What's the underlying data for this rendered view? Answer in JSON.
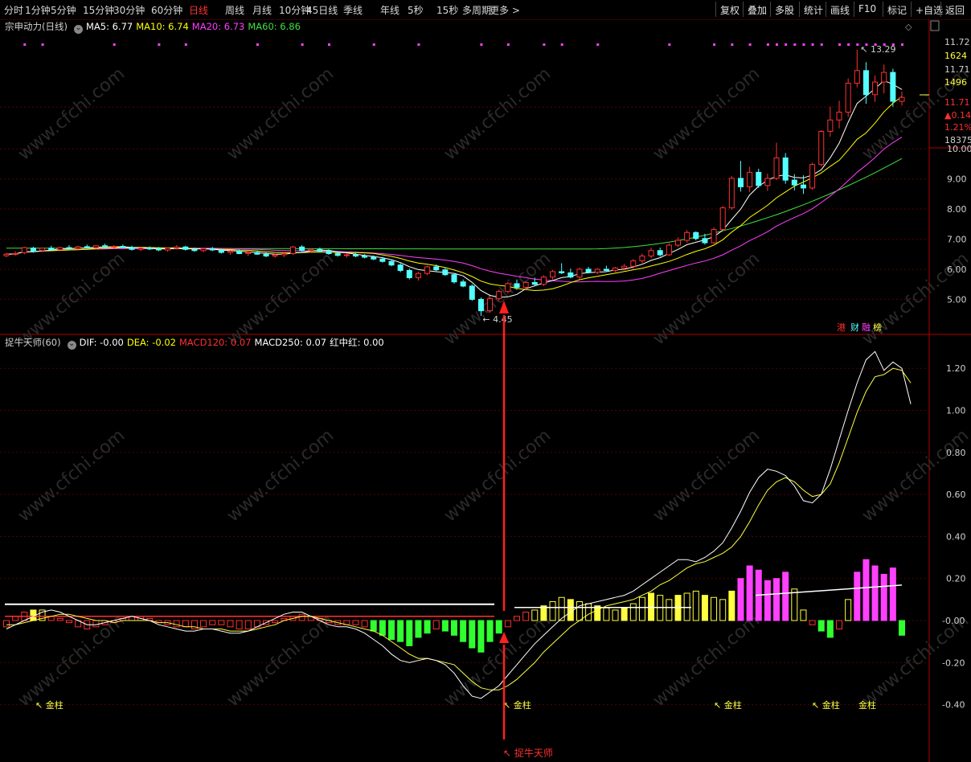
{
  "toolbar": {
    "periods": [
      "分时",
      "1分钟",
      "5分钟",
      "15分钟",
      "30分钟",
      "60分钟",
      "日线",
      "周线",
      "月线",
      "10分钟",
      "45日线",
      "季线",
      "年线",
      "5秒",
      "15秒",
      "多周期",
      "更多 >"
    ],
    "active_period": "日线",
    "right_buttons": [
      "复权",
      "叠加",
      "多股",
      "统计",
      "画线",
      "F10",
      "标记",
      "+自选",
      "返回"
    ]
  },
  "main_legend": {
    "title": "宗申动力(日线)",
    "items": [
      {
        "label": "MA5: 6.77",
        "color": "#ffffff"
      },
      {
        "label": "MA10: 6.74",
        "color": "#ffff00"
      },
      {
        "label": "MA20: 6.73",
        "color": "#ff40ff"
      },
      {
        "label": "MA60: 6.86",
        "color": "#40e040"
      }
    ]
  },
  "indicator_legend": {
    "title": "捉牛天师(60)",
    "items": [
      {
        "label": "DIF: -0.00",
        "color": "#ffffff"
      },
      {
        "label": "DEA: -0.02",
        "color": "#ffff00"
      },
      {
        "label": "MACD120: 0.07",
        "color": "#ff3030"
      },
      {
        "label": "MACD250: 0.07",
        "color": "#ffffff"
      },
      {
        "label": "红中红: 0.00",
        "color": "#ffffff"
      }
    ]
  },
  "right_panel": {
    "price1": "11.72",
    "vol1": "1624",
    "price2": "11.71",
    "vol2": "1496",
    "price3": "11.71",
    "change": "▲0.14",
    "pct": "1.21%",
    "volume": "18375"
  },
  "badges": {
    "gang": "港",
    "caiwu": "财",
    "rongzi": "融",
    "bang": "榜"
  },
  "annotations": {
    "high": "13.29",
    "low": "4.45",
    "jinzhu": "金柱",
    "signal": "捉牛天师"
  },
  "watermark": "www.cfchi.com",
  "chart_data": [
    {
      "type": "candlestick",
      "title": "宗申动力(日线)",
      "y_ticks": [
        5.0,
        6.0,
        7.0,
        8.0,
        9.0,
        10.0,
        11.71
      ],
      "ylim": [
        4.4,
        13.4
      ],
      "annotated_high": 13.29,
      "annotated_low": 4.45,
      "candles": [
        [
          6.45,
          6.55,
          6.4,
          6.5
        ],
        [
          6.5,
          6.6,
          6.45,
          6.52
        ],
        [
          6.55,
          6.75,
          6.5,
          6.72
        ],
        [
          6.7,
          6.75,
          6.55,
          6.6
        ],
        [
          6.62,
          6.72,
          6.58,
          6.7
        ],
        [
          6.7,
          6.78,
          6.6,
          6.65
        ],
        [
          6.65,
          6.75,
          6.6,
          6.72
        ],
        [
          6.72,
          6.8,
          6.65,
          6.7
        ],
        [
          6.7,
          6.78,
          6.62,
          6.75
        ],
        [
          6.75,
          6.82,
          6.7,
          6.72
        ],
        [
          6.72,
          6.8,
          6.68,
          6.78
        ],
        [
          6.78,
          6.85,
          6.7,
          6.74
        ],
        [
          6.74,
          6.8,
          6.68,
          6.76
        ],
        [
          6.76,
          6.82,
          6.7,
          6.72
        ],
        [
          6.72,
          6.78,
          6.62,
          6.66
        ],
        [
          6.66,
          6.74,
          6.6,
          6.7
        ],
        [
          6.7,
          6.76,
          6.64,
          6.68
        ],
        [
          6.68,
          6.74,
          6.6,
          6.64
        ],
        [
          6.64,
          6.72,
          6.58,
          6.7
        ],
        [
          6.7,
          6.8,
          6.66,
          6.74
        ],
        [
          6.74,
          6.78,
          6.62,
          6.66
        ],
        [
          6.66,
          6.72,
          6.58,
          6.62
        ],
        [
          6.62,
          6.7,
          6.56,
          6.68
        ],
        [
          6.68,
          6.74,
          6.6,
          6.64
        ],
        [
          6.64,
          6.68,
          6.52,
          6.56
        ],
        [
          6.56,
          6.64,
          6.48,
          6.6
        ],
        [
          6.6,
          6.66,
          6.5,
          6.52
        ],
        [
          6.52,
          6.6,
          6.44,
          6.56
        ],
        [
          6.56,
          6.62,
          6.48,
          6.5
        ],
        [
          6.5,
          6.56,
          6.4,
          6.44
        ],
        [
          6.44,
          6.52,
          6.38,
          6.48
        ],
        [
          6.48,
          6.56,
          6.4,
          6.52
        ],
        [
          6.52,
          6.78,
          6.48,
          6.74
        ],
        [
          6.74,
          6.8,
          6.58,
          6.62
        ],
        [
          6.62,
          6.7,
          6.54,
          6.66
        ],
        [
          6.66,
          6.72,
          6.56,
          6.6
        ],
        [
          6.6,
          6.66,
          6.48,
          6.52
        ],
        [
          6.52,
          6.58,
          6.42,
          6.46
        ],
        [
          6.46,
          6.52,
          6.38,
          6.48
        ],
        [
          6.48,
          6.54,
          6.4,
          6.44
        ],
        [
          6.44,
          6.5,
          6.36,
          6.4
        ],
        [
          6.4,
          6.46,
          6.3,
          6.34
        ],
        [
          6.34,
          6.4,
          6.22,
          6.26
        ],
        [
          6.26,
          6.32,
          6.1,
          6.14
        ],
        [
          6.14,
          6.2,
          5.9,
          5.96
        ],
        [
          5.96,
          6.02,
          5.66,
          5.72
        ],
        [
          5.72,
          5.92,
          5.62,
          5.86
        ],
        [
          5.86,
          6.12,
          5.8,
          6.08
        ],
        [
          6.08,
          6.16,
          5.94,
          5.98
        ],
        [
          5.98,
          6.06,
          5.78,
          5.82
        ],
        [
          5.82,
          5.88,
          5.52,
          5.58
        ],
        [
          5.58,
          5.66,
          5.4,
          5.44
        ],
        [
          5.44,
          5.5,
          4.95,
          5.0
        ],
        [
          5.0,
          5.06,
          4.45,
          4.62
        ],
        [
          4.62,
          5.1,
          4.56,
          5.02
        ],
        [
          5.02,
          5.32,
          4.96,
          5.26
        ],
        [
          5.26,
          5.58,
          5.2,
          5.52
        ],
        [
          5.52,
          5.66,
          5.32,
          5.4
        ],
        [
          5.4,
          5.6,
          5.3,
          5.56
        ],
        [
          5.56,
          5.72,
          5.44,
          5.5
        ],
        [
          5.5,
          5.8,
          5.44,
          5.74
        ],
        [
          5.74,
          5.98,
          5.66,
          5.92
        ],
        [
          5.92,
          6.2,
          5.84,
          5.88
        ],
        [
          5.88,
          6.02,
          5.7,
          5.74
        ],
        [
          5.74,
          6.06,
          5.68,
          6.0
        ],
        [
          6.0,
          6.08,
          5.86,
          5.9
        ],
        [
          5.9,
          6.04,
          5.84,
          6.0
        ],
        [
          6.0,
          6.12,
          5.92,
          5.96
        ],
        [
          5.96,
          6.08,
          5.9,
          6.04
        ],
        [
          6.04,
          6.18,
          5.96,
          6.1
        ],
        [
          6.1,
          6.34,
          6.02,
          6.28
        ],
        [
          6.28,
          6.52,
          6.2,
          6.44
        ],
        [
          6.44,
          6.72,
          6.36,
          6.62
        ],
        [
          6.62,
          6.72,
          6.42,
          6.48
        ],
        [
          6.48,
          6.86,
          6.44,
          6.8
        ],
        [
          6.8,
          7.06,
          6.74,
          6.96
        ],
        [
          6.96,
          7.3,
          6.88,
          7.22
        ],
        [
          7.22,
          7.26,
          6.96,
          7.02
        ],
        [
          7.02,
          7.18,
          6.82,
          6.88
        ],
        [
          6.88,
          7.4,
          6.84,
          7.32
        ],
        [
          7.32,
          8.1,
          7.28,
          8.04
        ],
        [
          8.04,
          9.1,
          7.98,
          9.02
        ],
        [
          9.02,
          9.6,
          8.58,
          8.74
        ],
        [
          8.74,
          9.4,
          8.56,
          9.22
        ],
        [
          9.22,
          9.34,
          8.7,
          8.78
        ],
        [
          8.78,
          9.18,
          8.6,
          9.02
        ],
        [
          9.02,
          10.2,
          8.96,
          9.7
        ],
        [
          9.7,
          9.86,
          8.84,
          8.96
        ],
        [
          8.96,
          9.16,
          8.62,
          8.8
        ],
        [
          8.8,
          9.12,
          8.5,
          8.7
        ],
        [
          8.7,
          9.54,
          8.64,
          9.48
        ],
        [
          9.48,
          10.62,
          9.42,
          10.58
        ],
        [
          10.58,
          11.4,
          10.4,
          10.96
        ],
        [
          10.96,
          11.6,
          10.68,
          11.22
        ],
        [
          11.22,
          12.34,
          11.06,
          12.18
        ],
        [
          12.18,
          13.29,
          12.04,
          12.6
        ],
        [
          12.6,
          12.88,
          11.5,
          11.8
        ],
        [
          11.8,
          12.44,
          11.56,
          12.22
        ],
        [
          12.22,
          12.8,
          11.84,
          12.54
        ],
        [
          12.54,
          12.66,
          11.4,
          11.58
        ],
        [
          11.58,
          11.9,
          11.44,
          11.71
        ]
      ],
      "series": [
        {
          "name": "MA5",
          "color": "#ffffff",
          "last": 6.77
        },
        {
          "name": "MA10",
          "color": "#ffff00",
          "last": 6.74
        },
        {
          "name": "MA20",
          "color": "#ff40ff",
          "last": 6.73
        },
        {
          "name": "MA60",
          "color": "#40e040",
          "last": 6.86
        }
      ]
    },
    {
      "type": "bar+line",
      "title": "捉牛天师(60)",
      "y_ticks": [
        -0.4,
        -0.2,
        -0.0,
        0.2,
        0.4,
        0.6,
        0.8,
        1.0,
        1.2
      ],
      "ylim": [
        -0.46,
        1.32
      ],
      "bars": [
        -0.03,
        0.02,
        0.04,
        0.05,
        0.05,
        0.02,
        0.01,
        -0.01,
        -0.03,
        -0.04,
        -0.03,
        -0.02,
        -0.01,
        0.01,
        0.02,
        0.02,
        0.01,
        -0.01,
        -0.02,
        -0.03,
        -0.03,
        -0.04,
        -0.03,
        -0.02,
        -0.02,
        -0.03,
        -0.04,
        -0.04,
        -0.03,
        -0.02,
        -0.01,
        0.01,
        0.02,
        0.03,
        0.02,
        0.01,
        -0.01,
        -0.02,
        -0.02,
        -0.02,
        -0.03,
        -0.05,
        -0.07,
        -0.09,
        -0.1,
        -0.12,
        -0.08,
        -0.06,
        -0.04,
        -0.05,
        -0.07,
        -0.1,
        -0.13,
        -0.15,
        -0.1,
        -0.06,
        -0.03,
        0.02,
        0.04,
        0.05,
        0.07,
        0.09,
        0.11,
        0.1,
        0.09,
        0.08,
        0.07,
        0.06,
        0.05,
        0.06,
        0.08,
        0.11,
        0.13,
        0.12,
        0.1,
        0.12,
        0.13,
        0.14,
        0.12,
        0.11,
        0.1,
        0.14,
        0.2,
        0.26,
        0.24,
        0.19,
        0.2,
        0.23,
        0.15,
        0.05,
        -0.02,
        -0.05,
        -0.08,
        -0.04,
        0.1,
        0.23,
        0.29,
        0.26,
        0.22,
        0.25,
        -0.07
      ],
      "dif": [
        -0.04,
        -0.02,
        0.0,
        0.02,
        0.04,
        0.05,
        0.04,
        0.02,
        -0.0,
        -0.02,
        -0.02,
        -0.01,
        0.0,
        0.01,
        0.02,
        0.01,
        0.0,
        -0.02,
        -0.03,
        -0.04,
        -0.05,
        -0.05,
        -0.04,
        -0.04,
        -0.05,
        -0.06,
        -0.06,
        -0.05,
        -0.03,
        -0.01,
        0.01,
        0.03,
        0.04,
        0.04,
        0.02,
        0.0,
        -0.02,
        -0.03,
        -0.03,
        -0.04,
        -0.06,
        -0.09,
        -0.12,
        -0.16,
        -0.19,
        -0.2,
        -0.19,
        -0.18,
        -0.19,
        -0.21,
        -0.25,
        -0.31,
        -0.36,
        -0.37,
        -0.34,
        -0.31,
        -0.26,
        -0.21,
        -0.16,
        -0.11,
        -0.07,
        -0.03,
        0.01,
        0.04,
        0.07,
        0.08,
        0.09,
        0.1,
        0.11,
        0.12,
        0.14,
        0.17,
        0.2,
        0.23,
        0.26,
        0.29,
        0.29,
        0.28,
        0.3,
        0.33,
        0.37,
        0.44,
        0.52,
        0.61,
        0.68,
        0.72,
        0.71,
        0.69,
        0.64,
        0.57,
        0.56,
        0.6,
        0.72,
        0.86,
        1.0,
        1.13,
        1.24,
        1.28,
        1.19,
        1.23,
        1.2,
        1.03
      ],
      "dea": [
        -0.02,
        -0.02,
        -0.01,
        0.0,
        0.01,
        0.02,
        0.03,
        0.03,
        0.02,
        0.01,
        0.0,
        -0.0,
        -0.01,
        -0.0,
        0.0,
        0.0,
        0.0,
        -0.01,
        -0.01,
        -0.02,
        -0.03,
        -0.03,
        -0.04,
        -0.04,
        -0.04,
        -0.05,
        -0.05,
        -0.05,
        -0.04,
        -0.03,
        -0.02,
        -0.0,
        0.01,
        0.02,
        0.02,
        0.01,
        0.0,
        -0.01,
        -0.02,
        -0.03,
        -0.04,
        -0.05,
        -0.07,
        -0.1,
        -0.13,
        -0.16,
        -0.18,
        -0.18,
        -0.19,
        -0.2,
        -0.21,
        -0.25,
        -0.29,
        -0.32,
        -0.33,
        -0.33,
        -0.31,
        -0.28,
        -0.24,
        -0.2,
        -0.15,
        -0.11,
        -0.07,
        -0.03,
        0.0,
        0.03,
        0.05,
        0.07,
        0.08,
        0.09,
        0.1,
        0.12,
        0.14,
        0.17,
        0.19,
        0.22,
        0.25,
        0.27,
        0.28,
        0.3,
        0.32,
        0.35,
        0.4,
        0.47,
        0.55,
        0.62,
        0.66,
        0.68,
        0.66,
        0.62,
        0.59,
        0.6,
        0.65,
        0.75,
        0.87,
        0.99,
        1.09,
        1.16,
        1.17,
        1.2,
        1.19,
        1.13
      ],
      "white_level": 0.07,
      "red_level": 0.02
    }
  ]
}
